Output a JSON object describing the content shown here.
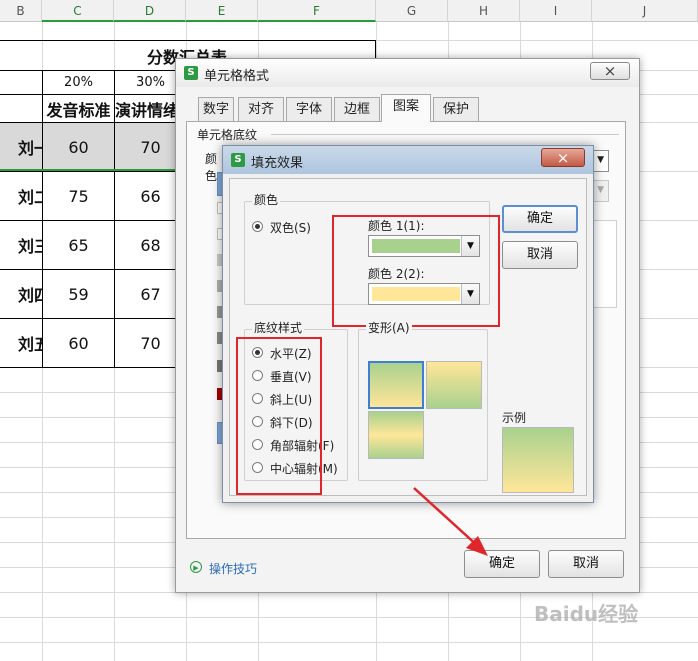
{
  "spreadsheet": {
    "columns": [
      "B",
      "C",
      "D",
      "E",
      "F",
      "G",
      "H",
      "I",
      "J"
    ],
    "title": "分数汇总表",
    "weights": [
      "20%",
      "30%"
    ],
    "headers": [
      "发音标准",
      "演讲情绪"
    ],
    "rows": [
      {
        "name": "刘一",
        "c": "60",
        "d": "70"
      },
      {
        "name": "刘二",
        "c": "75",
        "d": "66"
      },
      {
        "name": "刘三",
        "c": "65",
        "d": "68"
      },
      {
        "name": "刘四",
        "c": "59",
        "d": "67"
      },
      {
        "name": "刘五",
        "c": "60",
        "d": "70"
      }
    ]
  },
  "format_dialog": {
    "app_icon": "S",
    "title": "单元格格式",
    "close": "×",
    "tabs": [
      "数字",
      "对齐",
      "字体",
      "边框",
      "图案",
      "保护"
    ],
    "active_tab": "图案",
    "section_label": "单元格底纹",
    "color_label_fragment": "颜色",
    "tips_link": "操作技巧",
    "ok": "确定",
    "cancel": "取消"
  },
  "fill_dialog": {
    "title": "填充效果",
    "close": "×",
    "color_group": "颜色",
    "two_color": "双色(S)",
    "color1_label": "颜色 1(1):",
    "color2_label": "颜色 2(2):",
    "color1": "#a9d18e",
    "color2": "#ffe699",
    "shading_group": "底纹样式",
    "shading_options": [
      "水平(Z)",
      "垂直(V)",
      "斜上(U)",
      "斜下(D)",
      "角部辐射(F)",
      "中心辐射(M)"
    ],
    "selected_shading": "水平(Z)",
    "variants_label": "变形(A)",
    "sample_label": "示例",
    "ok": "确定",
    "cancel": "取消"
  },
  "watermark": "Baidu经验",
  "annotation_color": "#e0262a"
}
